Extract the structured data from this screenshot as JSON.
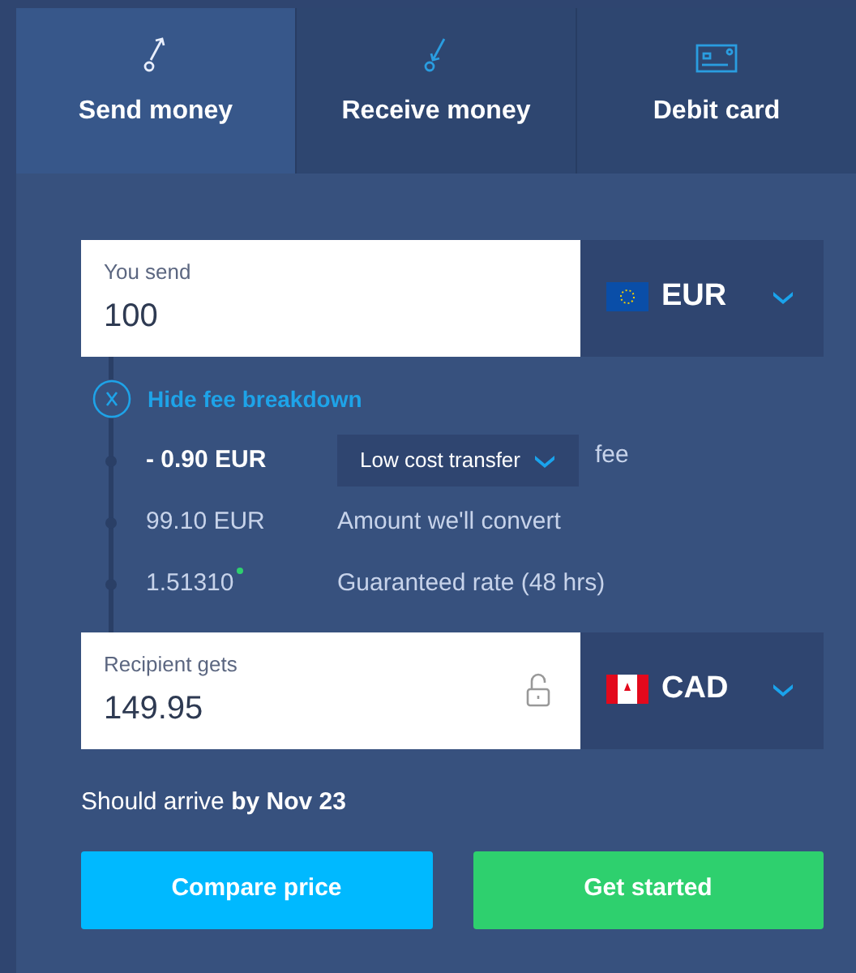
{
  "tabs": [
    {
      "label": "Send money",
      "selected": true
    },
    {
      "label": "Receive money",
      "selected": false
    },
    {
      "label": "Debit card",
      "selected": false
    }
  ],
  "send": {
    "label": "You send",
    "value": "100",
    "currency": "EUR"
  },
  "fee_toggle": "Hide fee breakdown",
  "fee_rows": [
    {
      "kind": "fee",
      "amount": "- 0.90 EUR",
      "option": "Low cost transfer",
      "suffix": "fee"
    },
    {
      "kind": "plain",
      "amount": "99.10 EUR",
      "text": "Amount we'll convert"
    },
    {
      "kind": "rate",
      "amount": "1.51310",
      "text": "Guaranteed rate (48 hrs)"
    }
  ],
  "receive": {
    "label": "Recipient gets",
    "value": "149.95",
    "currency": "CAD",
    "locked": false
  },
  "arrival": "Should arrive **by Nov 23**",
  "buttons": [
    {
      "label": "Compare price",
      "kind": "secondary"
    },
    {
      "label": "Get started",
      "kind": "primary"
    }
  ]
}
